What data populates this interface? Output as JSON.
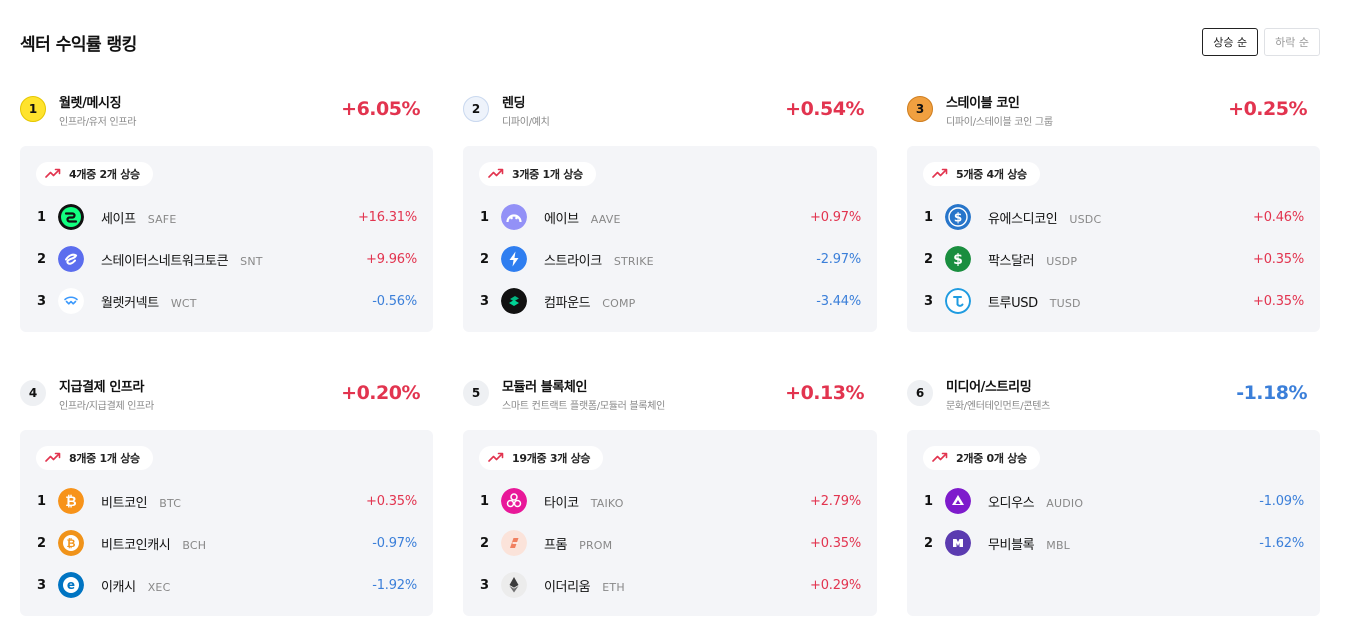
{
  "page": {
    "title": "섹터 수익률 랭킹",
    "sort_options": [
      "상승 순",
      "하락 순"
    ],
    "active_sort": "상승 순"
  },
  "sectors": [
    {
      "rank": "1",
      "name": "월렛/메시징",
      "sub": "인프라/유저 인프라",
      "change": "+6.05%",
      "direction": "up",
      "badge_color": "#ffe32d",
      "badge_border": "#e5c700",
      "badge_text_color": "#111",
      "summary": "4개중 2개 상승",
      "coins": [
        {
          "rank": "1",
          "name": "세이프",
          "symbol": "SAFE",
          "change": "+16.31%",
          "direction": "up",
          "icon": "safe-icon",
          "color": "#12ff80"
        },
        {
          "rank": "2",
          "name": "스테이터스네트워크토큰",
          "symbol": "SNT",
          "change": "+9.96%",
          "direction": "up",
          "icon": "status-icon",
          "color": "#5b6dee"
        },
        {
          "rank": "3",
          "name": "월렛커넥트",
          "symbol": "WCT",
          "change": "-0.56%",
          "direction": "down",
          "icon": "walletconnect-icon",
          "color": "#3b99fc"
        }
      ]
    },
    {
      "rank": "2",
      "name": "렌딩",
      "sub": "디파이/예치",
      "change": "+0.54%",
      "direction": "up",
      "badge_color": "#eef3fb",
      "badge_border": "#c9d8ef",
      "badge_text_color": "#111",
      "summary": "3개중 1개 상승",
      "coins": [
        {
          "rank": "1",
          "name": "에이브",
          "symbol": "AAVE",
          "change": "+0.97%",
          "direction": "up",
          "icon": "aave-icon",
          "color": "#9391f7"
        },
        {
          "rank": "2",
          "name": "스트라이크",
          "symbol": "STRIKE",
          "change": "-2.97%",
          "direction": "down",
          "icon": "strike-icon",
          "color": "#2f7ef0"
        },
        {
          "rank": "3",
          "name": "컴파운드",
          "symbol": "COMP",
          "change": "-3.44%",
          "direction": "down",
          "icon": "compound-icon",
          "color": "#00d395"
        }
      ]
    },
    {
      "rank": "3",
      "name": "스테이블 코인",
      "sub": "디파이/스테이블 코인 그룹",
      "change": "+0.25%",
      "direction": "up",
      "badge_color": "#f0a040",
      "badge_border": "#cf7d1e",
      "badge_text_color": "#111",
      "summary": "5개중 4개 상승",
      "coins": [
        {
          "rank": "1",
          "name": "유에스디코인",
          "symbol": "USDC",
          "change": "+0.46%",
          "direction": "up",
          "icon": "usdc-icon",
          "color": "#2775ca"
        },
        {
          "rank": "2",
          "name": "팍스달러",
          "symbol": "USDP",
          "change": "+0.35%",
          "direction": "up",
          "icon": "usdp-icon",
          "color": "#1a8e3f"
        },
        {
          "rank": "3",
          "name": "트루USD",
          "symbol": "TUSD",
          "change": "+0.35%",
          "direction": "up",
          "icon": "tusd-icon",
          "color": "#1f9be0"
        }
      ]
    },
    {
      "rank": "4",
      "name": "지급결제 인프라",
      "sub": "인프라/지급결제 인프라",
      "change": "+0.20%",
      "direction": "up",
      "badge_color": "#eef0f3",
      "badge_border": "#eef0f3",
      "badge_text_color": "#111",
      "summary": "8개중 1개 상승",
      "coins": [
        {
          "rank": "1",
          "name": "비트코인",
          "symbol": "BTC",
          "change": "+0.35%",
          "direction": "up",
          "icon": "bitcoin-icon",
          "color": "#f7931a"
        },
        {
          "rank": "2",
          "name": "비트코인캐시",
          "symbol": "BCH",
          "change": "-0.97%",
          "direction": "down",
          "icon": "bitcoincash-icon",
          "color": "#f0931a"
        },
        {
          "rank": "3",
          "name": "이캐시",
          "symbol": "XEC",
          "change": "-1.92%",
          "direction": "down",
          "icon": "ecash-icon",
          "color": "#0074c2"
        }
      ]
    },
    {
      "rank": "5",
      "name": "모듈러 블록체인",
      "sub": "스마트 컨트랙트 플랫폼/모듈러 블록체인",
      "change": "+0.13%",
      "direction": "up",
      "badge_color": "#eef0f3",
      "badge_border": "#eef0f3",
      "badge_text_color": "#111",
      "summary": "19개중 3개 상승",
      "coins": [
        {
          "rank": "1",
          "name": "타이코",
          "symbol": "TAIKO",
          "change": "+2.79%",
          "direction": "up",
          "icon": "taiko-icon",
          "color": "#e81899"
        },
        {
          "rank": "2",
          "name": "프롬",
          "symbol": "PROM",
          "change": "+0.35%",
          "direction": "up",
          "icon": "prom-icon",
          "color": "#f08060"
        },
        {
          "rank": "3",
          "name": "이더리움",
          "symbol": "ETH",
          "change": "+0.29%",
          "direction": "up",
          "icon": "ethereum-icon",
          "color": "#3c3c3d"
        }
      ]
    },
    {
      "rank": "6",
      "name": "미디어/스트리밍",
      "sub": "문화/엔터테인먼트/콘텐츠",
      "change": "-1.18%",
      "direction": "down",
      "badge_color": "#eef0f3",
      "badge_border": "#eef0f3",
      "badge_text_color": "#111",
      "summary": "2개중 0개 상승",
      "coins": [
        {
          "rank": "1",
          "name": "오디우스",
          "symbol": "AUDIO",
          "change": "-1.09%",
          "direction": "down",
          "icon": "audius-icon",
          "color": "#7e1bcc"
        },
        {
          "rank": "2",
          "name": "무비블록",
          "symbol": "MBL",
          "change": "-1.62%",
          "direction": "down",
          "icon": "moviebloc-icon",
          "color": "#5b3bb0"
        }
      ]
    }
  ],
  "colors": {
    "up": "#e2344f",
    "down": "#3b7fd9",
    "card_bg": "#f4f5f8"
  }
}
